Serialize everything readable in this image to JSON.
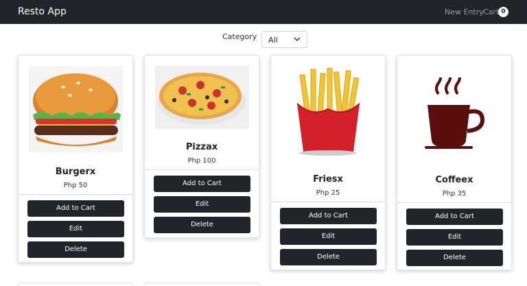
{
  "navbar": {
    "brand": "Resto App",
    "new_entry": "New Entry",
    "cart": "Cart",
    "cart_count": "0"
  },
  "filter": {
    "label": "Category",
    "selected": "All"
  },
  "products": [
    {
      "name": "Burgerx",
      "price": "Php 50",
      "image": "burger"
    },
    {
      "name": "Pizzax",
      "price": "Php 100",
      "image": "pizza"
    },
    {
      "name": "Friesx",
      "price": "Php 25",
      "image": "fries"
    },
    {
      "name": "Coffeex",
      "price": "Php 35",
      "image": "coffee"
    }
  ],
  "actions": {
    "add_to_cart": "Add to Cart",
    "edit": "Edit",
    "delete": "Delete"
  },
  "colors": {
    "navbar": "#212529",
    "button": "#212529",
    "background": "#ffffff"
  }
}
